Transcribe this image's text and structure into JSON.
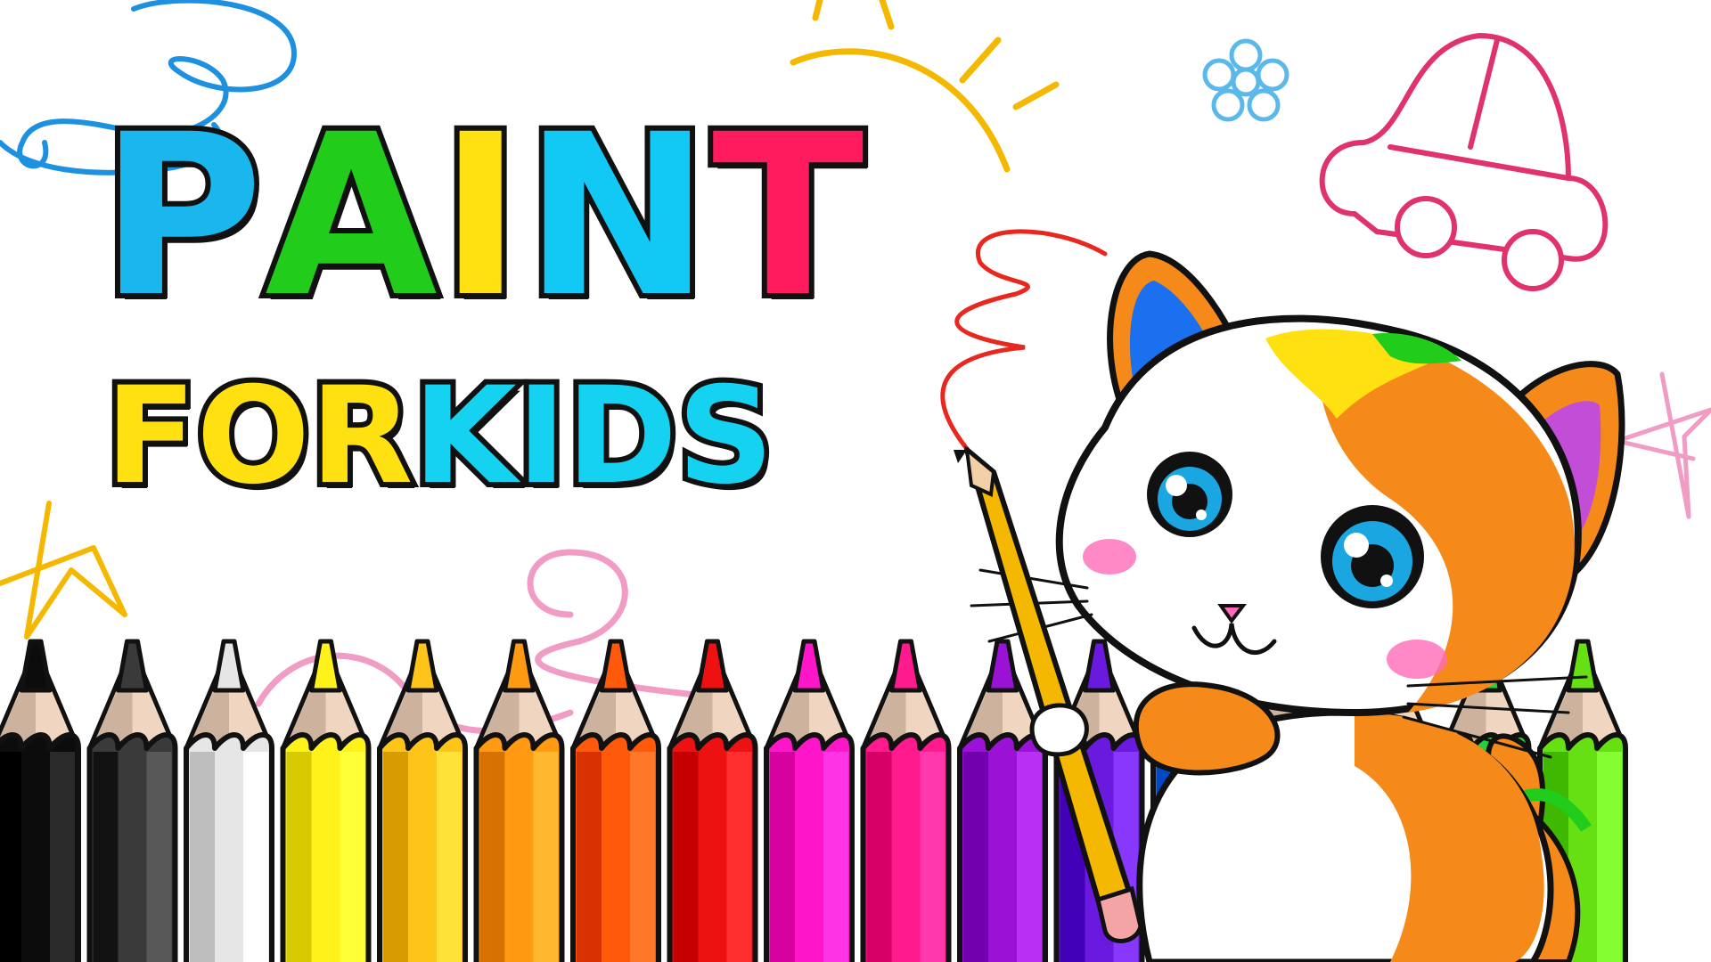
{
  "title": {
    "line1": [
      {
        "char": "P",
        "color": "#19b7ee"
      },
      {
        "char": "A",
        "color": "#22cc1a"
      },
      {
        "char": "I",
        "color": "#ffe010"
      },
      {
        "char": "N",
        "color": "#12c9f5"
      },
      {
        "char": "T",
        "color": "#ff1b5e"
      }
    ],
    "line2": [
      {
        "char": "F",
        "color": "#ffe010"
      },
      {
        "char": "O",
        "color": "#ffe010"
      },
      {
        "char": "R",
        "color": "#ffe010"
      },
      {
        "char": "K",
        "color": "#14d2f0"
      },
      {
        "char": "I",
        "color": "#14d2f0"
      },
      {
        "char": "D",
        "color": "#14d2f0"
      },
      {
        "char": "S",
        "color": "#14d2f0"
      }
    ]
  },
  "pencil_colors": [
    "#0c0c0c",
    "#3a3a3a",
    "#e6e6e6",
    "#fff21a",
    "#ffc41a",
    "#ff9a12",
    "#ff5a0c",
    "#ee1111",
    "#ff16c8",
    "#ff1a8e",
    "#9a12d6",
    "#6a1adf",
    "#1a70ee",
    "#12c6f0",
    "#14f0c6",
    "#22d33a",
    "#66e012"
  ],
  "colors": {
    "outline": "#111111",
    "doodle_blue": "#1e90e0",
    "doodle_yellow": "#f5b800",
    "doodle_red": "#e8271e",
    "doodle_pink": "#f09cc4",
    "doodle_magenta": "#e0336b",
    "cat_orange": "#f58a1a",
    "cat_white": "#ffffff",
    "cat_eye": "#1aa6e0"
  },
  "icons": [
    "cat-character-icon",
    "pencil-icon",
    "car-doodle-icon",
    "flower-doodle-icon",
    "star-doodle-icon"
  ]
}
